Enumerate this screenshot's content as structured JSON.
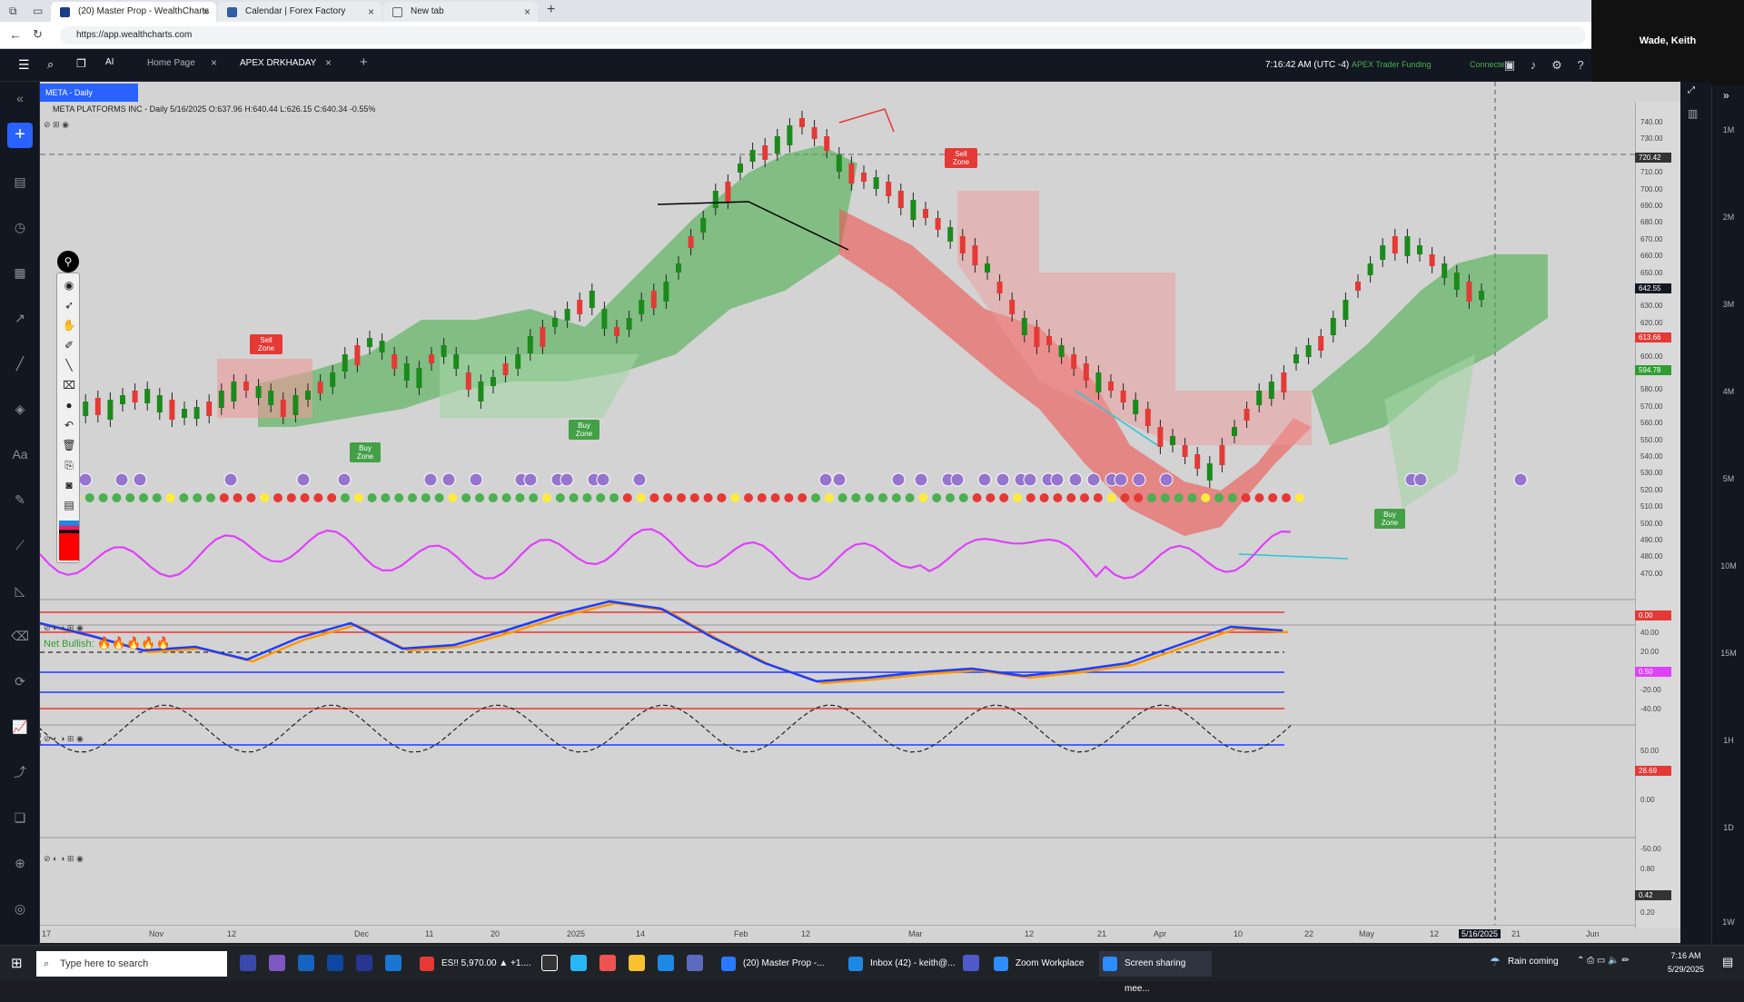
{
  "browser": {
    "tabs": [
      {
        "label": "(20) Master Prop - WealthCharts",
        "active": true
      },
      {
        "label": "Calendar | Forex Factory",
        "active": false
      },
      {
        "label": "New tab",
        "active": false
      }
    ],
    "url": "https://app.wealthcharts.com",
    "profile_name": "Wade, Keith"
  },
  "app_header": {
    "tabs": [
      "Home Page",
      "APEX DRKHADAY"
    ],
    "time": "7:16:42 AM  (UTC -4)",
    "account": "APEX Trader Funding",
    "status": "Connected"
  },
  "chart": {
    "symbol_tab": "META - Daily",
    "legend": "META PLATFORMS INC - Daily  5/16/2025  O:637.96  H:640.44  L:626.15  C:640.34  -0.55%",
    "net_bullish_label": "Net Bullish:",
    "zones": [
      "Sell Zone",
      "Buy Zone",
      "Buy Zone",
      "Sell Zone",
      "Buy Zone"
    ],
    "price_axis": [
      "740.00",
      "730.00",
      "720.00",
      "710.00",
      "700.00",
      "690.00",
      "680.00",
      "670.00",
      "660.00",
      "650.00",
      "640.00",
      "630.00",
      "620.00",
      "610.00",
      "600.00",
      "590.00",
      "580.00",
      "570.00",
      "560.00",
      "550.00",
      "540.00",
      "530.00",
      "520.00",
      "510.00",
      "500.00",
      "490.00",
      "480.00",
      "470.00"
    ],
    "price_tags": {
      "top_level": "720.42",
      "last": "642.55",
      "red": "613.66",
      "green": "594.78"
    },
    "osc_axis": [
      "40.00",
      "20.00",
      "0.00",
      "-20.00",
      "-40.00"
    ],
    "osc_tag": "0.50",
    "macd_axis": [
      "50.00",
      "0.00",
      "-50.00"
    ],
    "macd_tag": "28.69",
    "stoch_axis": [
      "0.80",
      "0.20"
    ],
    "stoch_tag": "0.42",
    "zero_tag": "0.00",
    "x_axis": [
      "17",
      "Nov",
      "12",
      "Dec",
      "11",
      "20",
      "2025",
      "14",
      "Feb",
      "12",
      "Mar",
      "12",
      "21",
      "Apr",
      "10",
      "22",
      "May",
      "12",
      "5/16/2025",
      "21",
      "Jun"
    ],
    "timeframes": [
      "1M",
      "2M",
      "3M",
      "4M",
      "5M",
      "10M",
      "15M",
      "1H",
      "1D",
      "1W"
    ]
  },
  "taskbar": {
    "search_placeholder": "Type here to search",
    "apps": [
      {
        "label": "ES!! 5,970.00 ▲ +1....",
        "color": "#e53935"
      },
      {
        "label": "(20) Master Prop -...",
        "color": "#2979ff"
      },
      {
        "label": "Inbox (42) - keith@...",
        "color": "#1e88e5"
      },
      {
        "label": "Zoom Workplace",
        "color": "#2d8cff"
      },
      {
        "label": "Screen sharing mee...",
        "color": "#2d8cff"
      }
    ],
    "weather": "Rain coming",
    "time": "7:16 AM",
    "date": "5/29/2025"
  }
}
